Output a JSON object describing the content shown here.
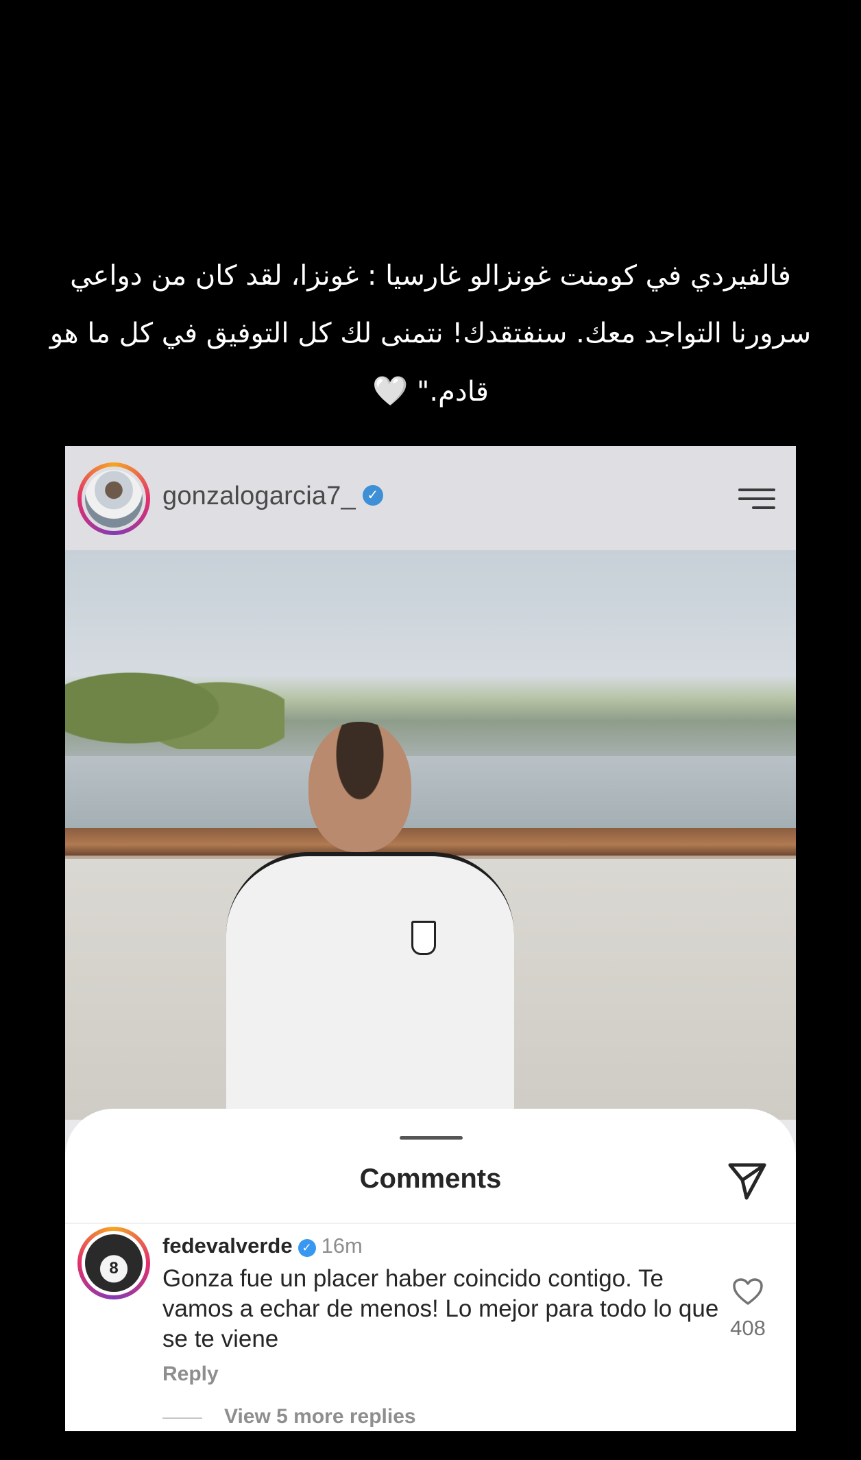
{
  "caption": {
    "text": "فالفيردي في كومنت غونزالو غارسيا : غونزا، لقد كان من دواعي سرورنا التواجد معك. سنفتقدك! نتمنى لك كل التوفيق في كل ما هو قادم.\"",
    "emoji": "🤍"
  },
  "post": {
    "username": "gonzalogarcia7_",
    "verified": true,
    "menu_icon": "hamburger-menu-icon"
  },
  "comments_sheet": {
    "title": "Comments",
    "send_icon": "paper-plane-icon",
    "comment": {
      "username": "fedevalverde",
      "verified": true,
      "time": "16m",
      "text": "Gonza fue un placer haber coincido contigo. Te vamos a echar de menos! Lo mejor para todo lo que se te viene",
      "reply_label": "Reply",
      "likes": "408",
      "view_replies": "View 5 more replies"
    }
  },
  "colors": {
    "background": "#000000",
    "caption_text": "#ffffff",
    "verified_blue": "#3897f0",
    "sheet_bg": "#ffffff",
    "muted_text": "#8e8e8e"
  }
}
